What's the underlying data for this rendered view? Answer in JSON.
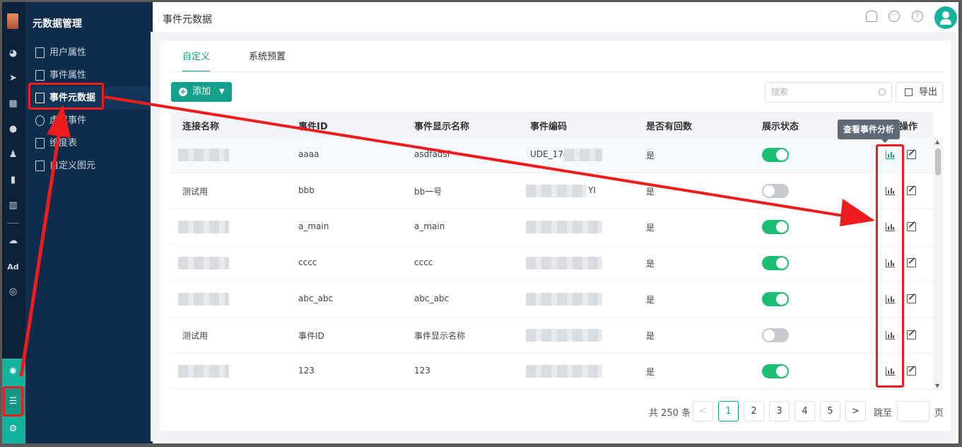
{
  "sidebar": {
    "title": "元数据管理",
    "items": [
      {
        "label": "用户属性"
      },
      {
        "label": "事件属性"
      },
      {
        "label": "事件元数据"
      },
      {
        "label": "虚拟事件"
      },
      {
        "label": "维度表"
      },
      {
        "label": "自定义图元"
      }
    ],
    "rail_text_ad": "Ad"
  },
  "header": {
    "title": "事件元数据",
    "icons": [
      "bell-icon",
      "chat-icon",
      "help-icon",
      "user-avatar"
    ]
  },
  "tabs": [
    {
      "label": "自定义",
      "active": true
    },
    {
      "label": "系统预置",
      "active": false
    }
  ],
  "toolbar": {
    "add_label": "添加",
    "search_placeholder": "搜索",
    "export_label": "导出"
  },
  "table": {
    "columns": [
      "连接名称",
      "事件ID",
      "事件显示名称",
      "事件编码",
      "是否有回数",
      "展示状态",
      "操作"
    ],
    "rows": [
      {
        "name": "",
        "event_id": "aaaa",
        "display_name": "asdfadsf",
        "code": "UDE_174",
        "has_callback": "是",
        "enabled": true
      },
      {
        "name": "测试用",
        "event_id": "bbb",
        "display_name": "bb一号",
        "code": "YI",
        "has_callback": "是",
        "enabled": false
      },
      {
        "name": "",
        "event_id": "a_main",
        "display_name": "a_main",
        "code": "",
        "has_callback": "是",
        "enabled": true
      },
      {
        "name": "",
        "event_id": "cccc",
        "display_name": "cccc",
        "code": "",
        "has_callback": "是",
        "enabled": true
      },
      {
        "name": "",
        "event_id": "abc_abc",
        "display_name": "abc_abc",
        "code": "",
        "has_callback": "是",
        "enabled": true
      },
      {
        "name": "测试用",
        "event_id": "事件ID",
        "display_name": "事件显示名称",
        "code": "",
        "has_callback": "是",
        "enabled": false
      },
      {
        "name": "",
        "event_id": "123",
        "display_name": "123",
        "code": "",
        "has_callback": "是",
        "enabled": true
      }
    ]
  },
  "tooltip": "查看事件分析",
  "pagination": {
    "total": "共 250 条",
    "pages": [
      "1",
      "2",
      "3",
      "4",
      "5"
    ],
    "current": "1",
    "prev": "<",
    "next": ">",
    "jump_label": "跳至",
    "unit": "页"
  },
  "colors": {
    "accent": "#14a08c",
    "sidebar_bg": "#0e2c4c",
    "rail_bg": "#0c2238",
    "toggle_on": "#1bbd73",
    "annotation_red": "#ee1c1c"
  }
}
